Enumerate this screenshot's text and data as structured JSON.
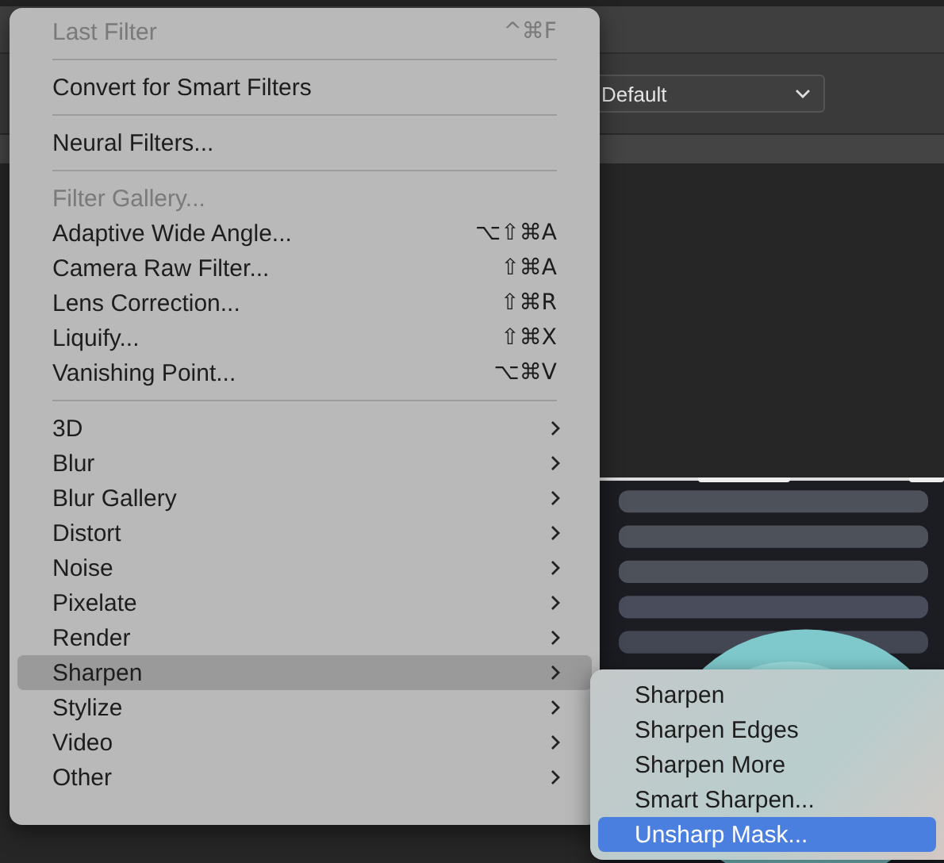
{
  "options_bar": {
    "preset": "Default"
  },
  "filter_menu": {
    "sections": [
      [
        {
          "label": "Last Filter",
          "shortcut": "^⌘F",
          "disabled": true,
          "has_submenu": false,
          "selected": false
        }
      ],
      [
        {
          "label": "Convert for Smart Filters",
          "disabled": false,
          "has_submenu": false,
          "selected": false
        }
      ],
      [
        {
          "label": "Neural Filters...",
          "disabled": false,
          "has_submenu": false,
          "selected": false
        }
      ],
      [
        {
          "label": "Filter Gallery...",
          "disabled": true,
          "has_submenu": false,
          "selected": false
        },
        {
          "label": "Adaptive Wide Angle...",
          "shortcut": "⌥⇧⌘A",
          "disabled": false,
          "has_submenu": false,
          "selected": false
        },
        {
          "label": "Camera Raw Filter...",
          "shortcut": "⇧⌘A",
          "disabled": false,
          "has_submenu": false,
          "selected": false
        },
        {
          "label": "Lens Correction...",
          "shortcut": "⇧⌘R",
          "disabled": false,
          "has_submenu": false,
          "selected": false
        },
        {
          "label": "Liquify...",
          "shortcut": "⇧⌘X",
          "disabled": false,
          "has_submenu": false,
          "selected": false
        },
        {
          "label": "Vanishing Point...",
          "shortcut": "⌥⌘V",
          "disabled": false,
          "has_submenu": false,
          "selected": false
        }
      ],
      [
        {
          "label": "3D",
          "disabled": false,
          "has_submenu": true,
          "selected": false
        },
        {
          "label": "Blur",
          "disabled": false,
          "has_submenu": true,
          "selected": false
        },
        {
          "label": "Blur Gallery",
          "disabled": false,
          "has_submenu": true,
          "selected": false
        },
        {
          "label": "Distort",
          "disabled": false,
          "has_submenu": true,
          "selected": false
        },
        {
          "label": "Noise",
          "disabled": false,
          "has_submenu": true,
          "selected": false
        },
        {
          "label": "Pixelate",
          "disabled": false,
          "has_submenu": true,
          "selected": false
        },
        {
          "label": "Render",
          "disabled": false,
          "has_submenu": true,
          "selected": false
        },
        {
          "label": "Sharpen",
          "disabled": false,
          "has_submenu": true,
          "selected": true
        },
        {
          "label": "Stylize",
          "disabled": false,
          "has_submenu": true,
          "selected": false
        },
        {
          "label": "Video",
          "disabled": false,
          "has_submenu": true,
          "selected": false
        },
        {
          "label": "Other",
          "disabled": false,
          "has_submenu": true,
          "selected": false
        }
      ]
    ]
  },
  "sharpen_submenu": {
    "items": [
      {
        "label": "Sharpen",
        "selected": false
      },
      {
        "label": "Sharpen Edges",
        "selected": false
      },
      {
        "label": "Sharpen More",
        "selected": false
      },
      {
        "label": "Smart Sharpen...",
        "selected": false
      },
      {
        "label": "Unsharp Mask...",
        "selected": true
      }
    ]
  }
}
